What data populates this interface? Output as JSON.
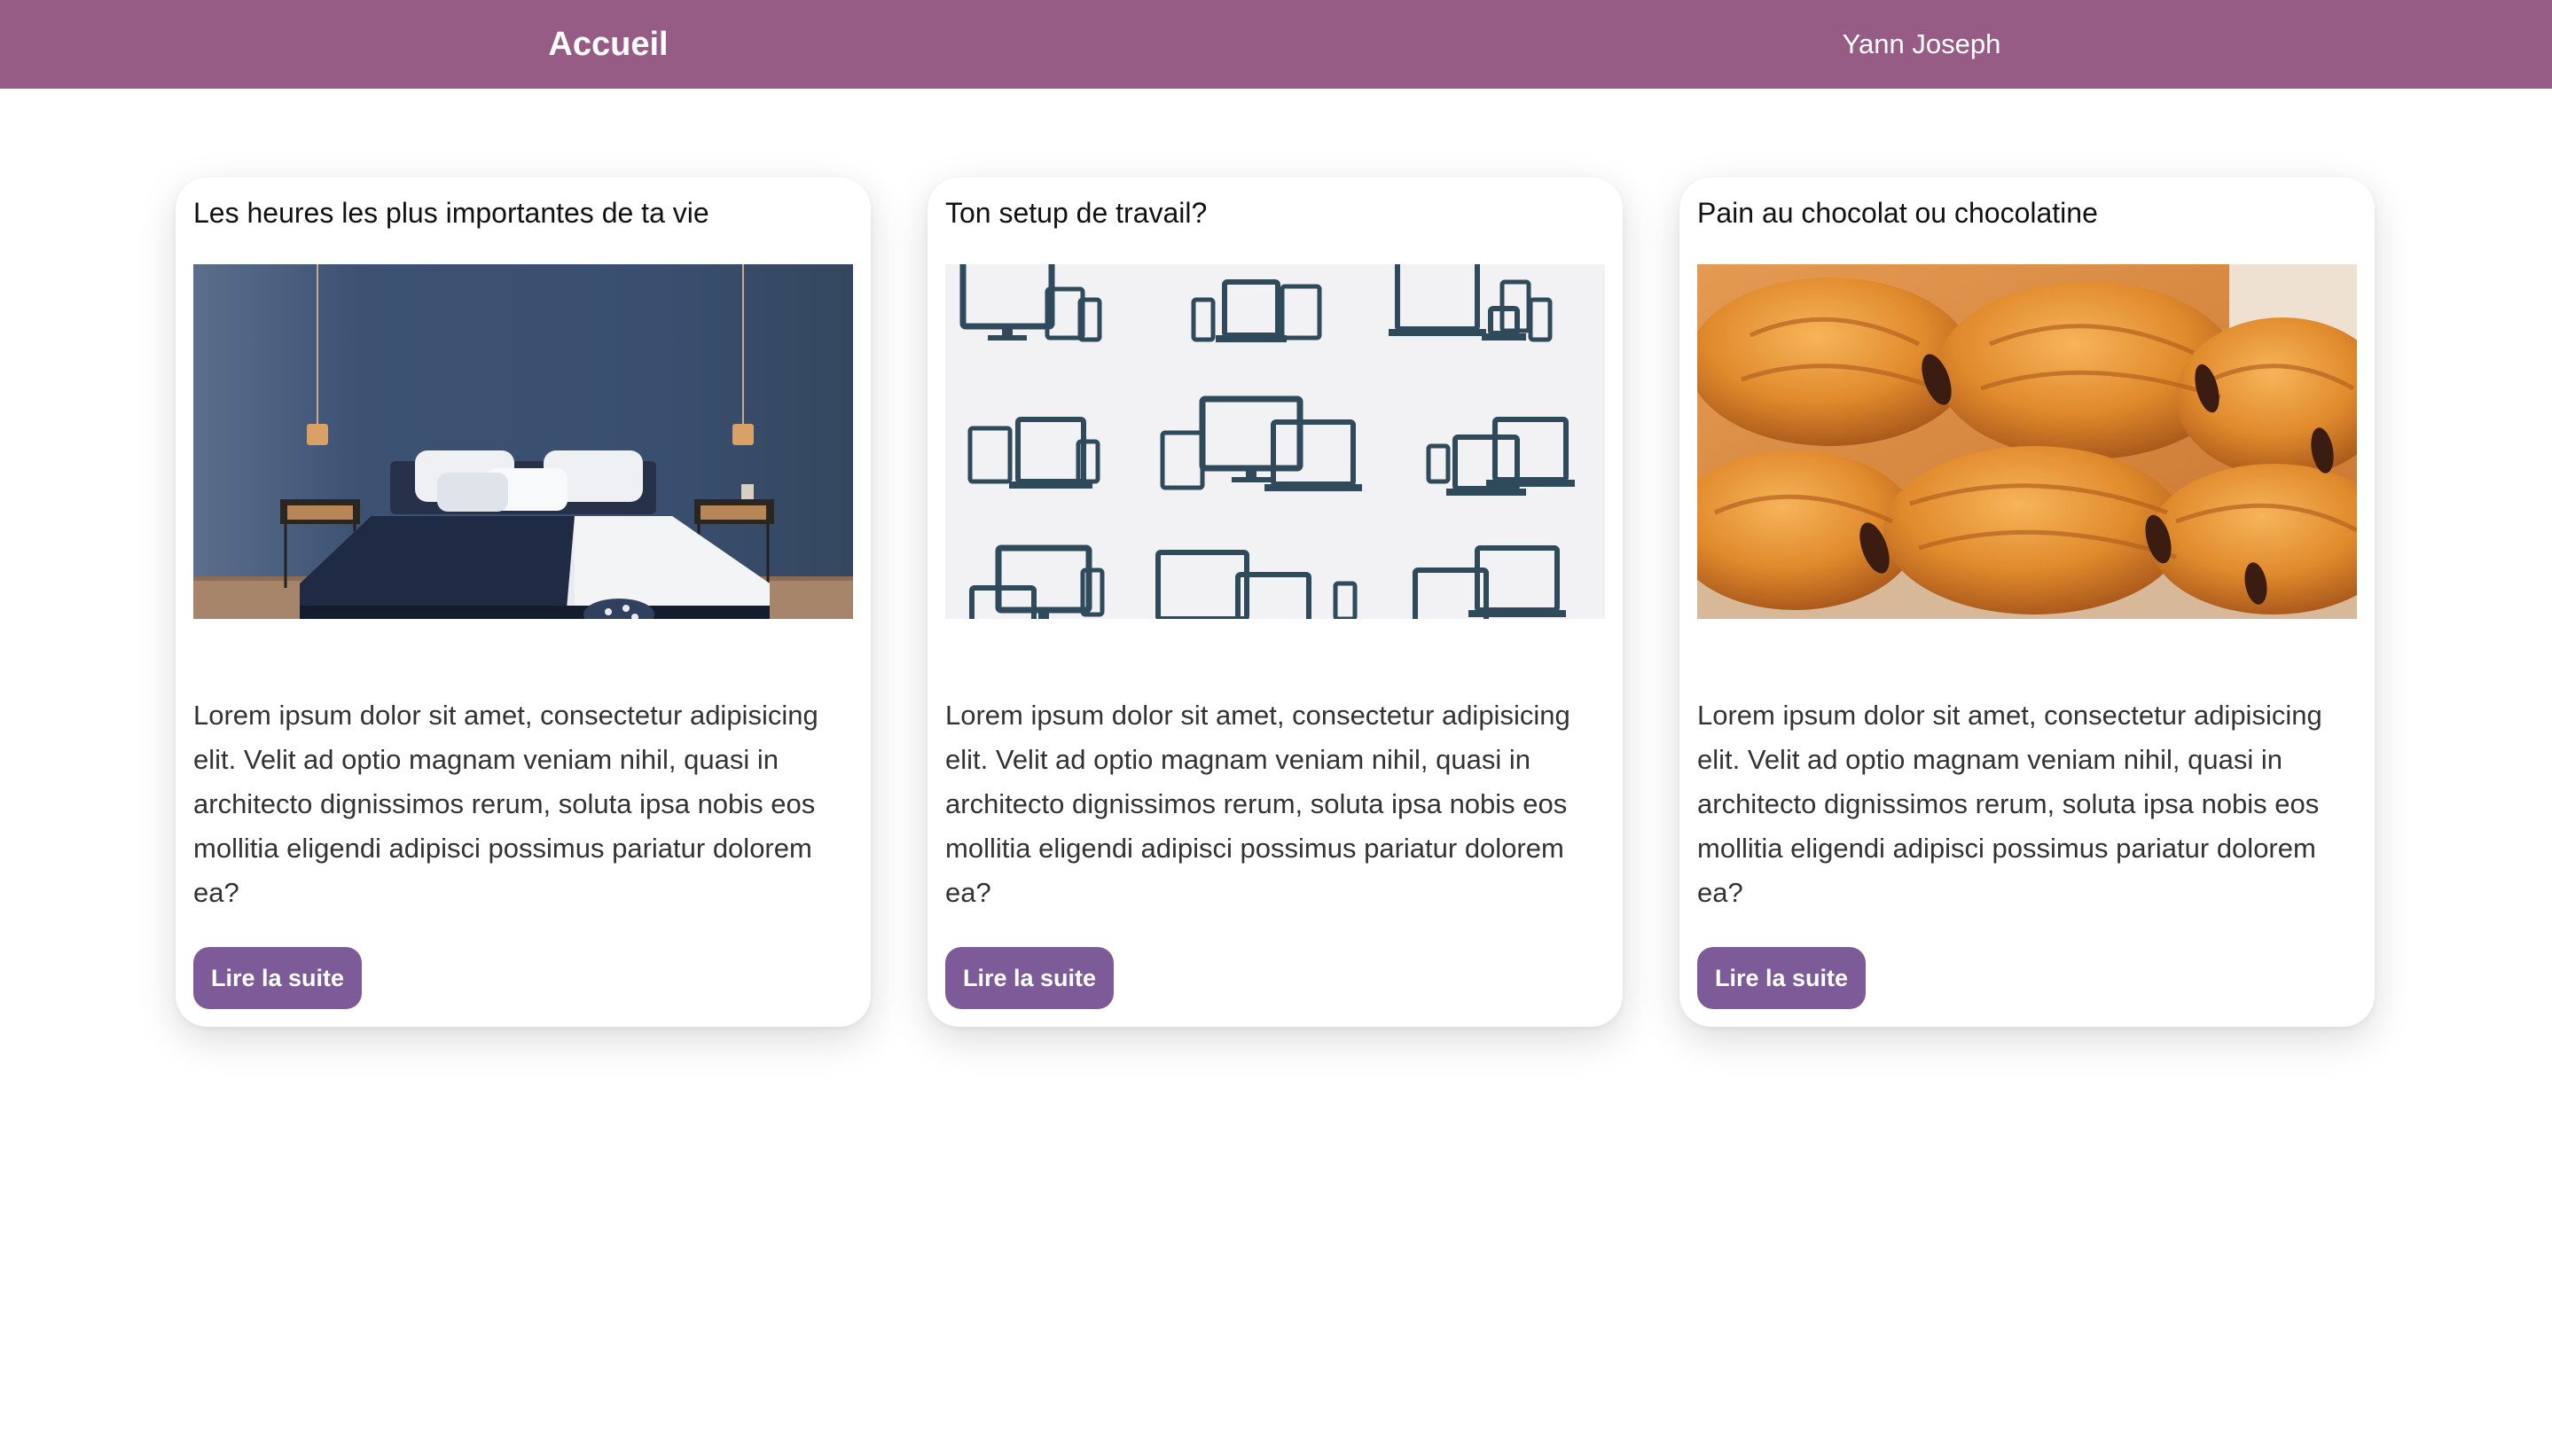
{
  "header": {
    "home_label": "Accueil",
    "user_name": "Yann Joseph",
    "background_color": "#965c85"
  },
  "cards": [
    {
      "title": "Les heures les plus importantes de ta vie",
      "image_subject": "bedroom-photo",
      "body": "Lorem ipsum dolor sit amet, consectetur adipisicing elit. Velit ad optio magnam veniam nihil, quasi in architecto dignissimos rerum, soluta ipsa nobis eos mollitia eligendi adipisci possimus pariatur dolorem ea?",
      "button_label": "Lire la suite"
    },
    {
      "title": "Ton setup de travail?",
      "image_subject": "devices-icons-illustration",
      "body": "Lorem ipsum dolor sit amet, consectetur adipisicing elit. Velit ad optio magnam veniam nihil, quasi in architecto dignissimos rerum, soluta ipsa nobis eos mollitia eligendi adipisci possimus pariatur dolorem ea?",
      "button_label": "Lire la suite"
    },
    {
      "title": "Pain au chocolat ou chocolatine",
      "image_subject": "pastry-photo",
      "body": "Lorem ipsum dolor sit amet, consectetur adipisicing elit. Velit ad optio magnam veniam nihil, quasi in architecto dignissimos rerum, soluta ipsa nobis eos mollitia eligendi adipisci possimus pariatur dolorem ea?",
      "button_label": "Lire la suite"
    }
  ],
  "colors": {
    "button": "#7d5b98",
    "card_background": "#ffffff"
  }
}
